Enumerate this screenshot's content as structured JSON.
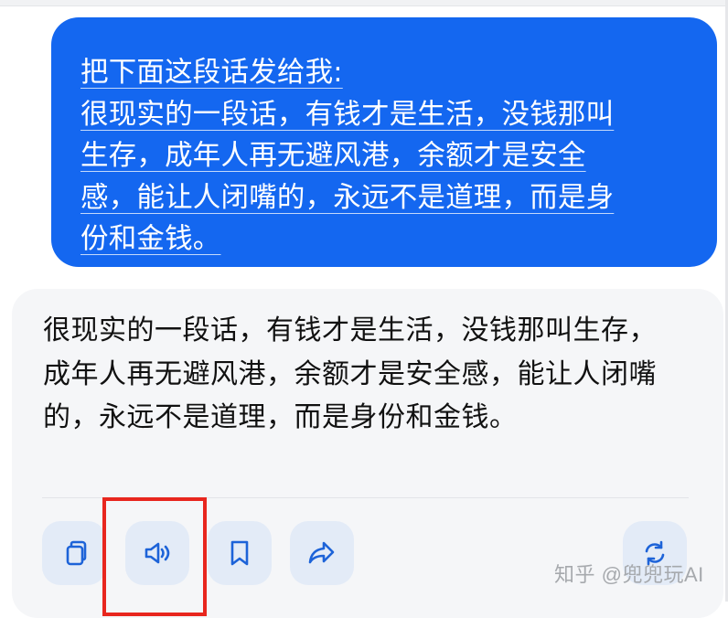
{
  "user_message": {
    "instruction": "把下面这段话发给我:",
    "lines": [
      "很现实的一段话，有钱才是生活，没钱那叫",
      "生存，成年人再无避风港，余额才是安全",
      "感，能让人闭嘴的，永远不是道理，而是身",
      "份和金钱。"
    ]
  },
  "assistant_reply": {
    "text": "很现实的一段话，有钱才是生活，没钱那叫生存，成年人再无避风港，余额才是安全感，能让人闭嘴的，永远不是道理，而是身份和金钱。"
  },
  "actions": [
    {
      "name": "copy",
      "icon": "copy-icon"
    },
    {
      "name": "read-aloud",
      "icon": "speaker-icon"
    },
    {
      "name": "bookmark",
      "icon": "bookmark-icon"
    },
    {
      "name": "share",
      "icon": "share-icon"
    },
    {
      "name": "regenerate",
      "icon": "refresh-icon"
    }
  ],
  "watermark": "知乎 @兜兜玩AI",
  "colors": {
    "user_bubble": "#1467f0",
    "reply_card": "#f5f6f8",
    "action_bg": "#e3ebf7",
    "action_icon": "#1d63d8",
    "highlight": "#e8261e"
  }
}
